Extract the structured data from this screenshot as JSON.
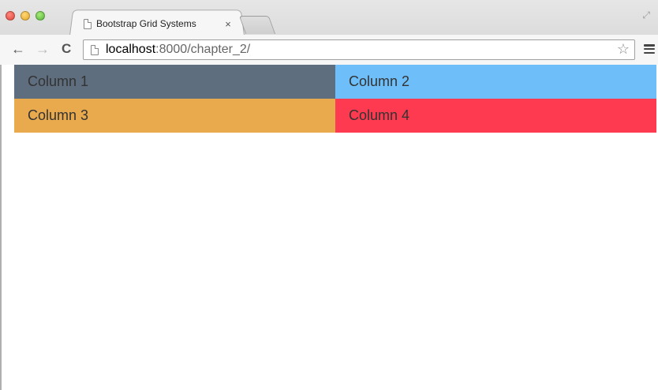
{
  "window": {
    "tab_title": "Bootstrap Grid Systems",
    "tab_close": "×",
    "resize_icon": "fullscreen-icon"
  },
  "toolbar": {
    "back": "←",
    "forward": "→",
    "reload": "C",
    "url_host": "localhost",
    "url_rest": ":8000/chapter_2/",
    "star": "☆"
  },
  "content": {
    "columns": [
      {
        "label": "Column 1",
        "color": "#5e6e7e"
      },
      {
        "label": "Column 2",
        "color": "#6ebff9"
      },
      {
        "label": "Column 3",
        "color": "#e9aa4e"
      },
      {
        "label": "Column 4",
        "color": "#fd3a4f"
      }
    ]
  }
}
